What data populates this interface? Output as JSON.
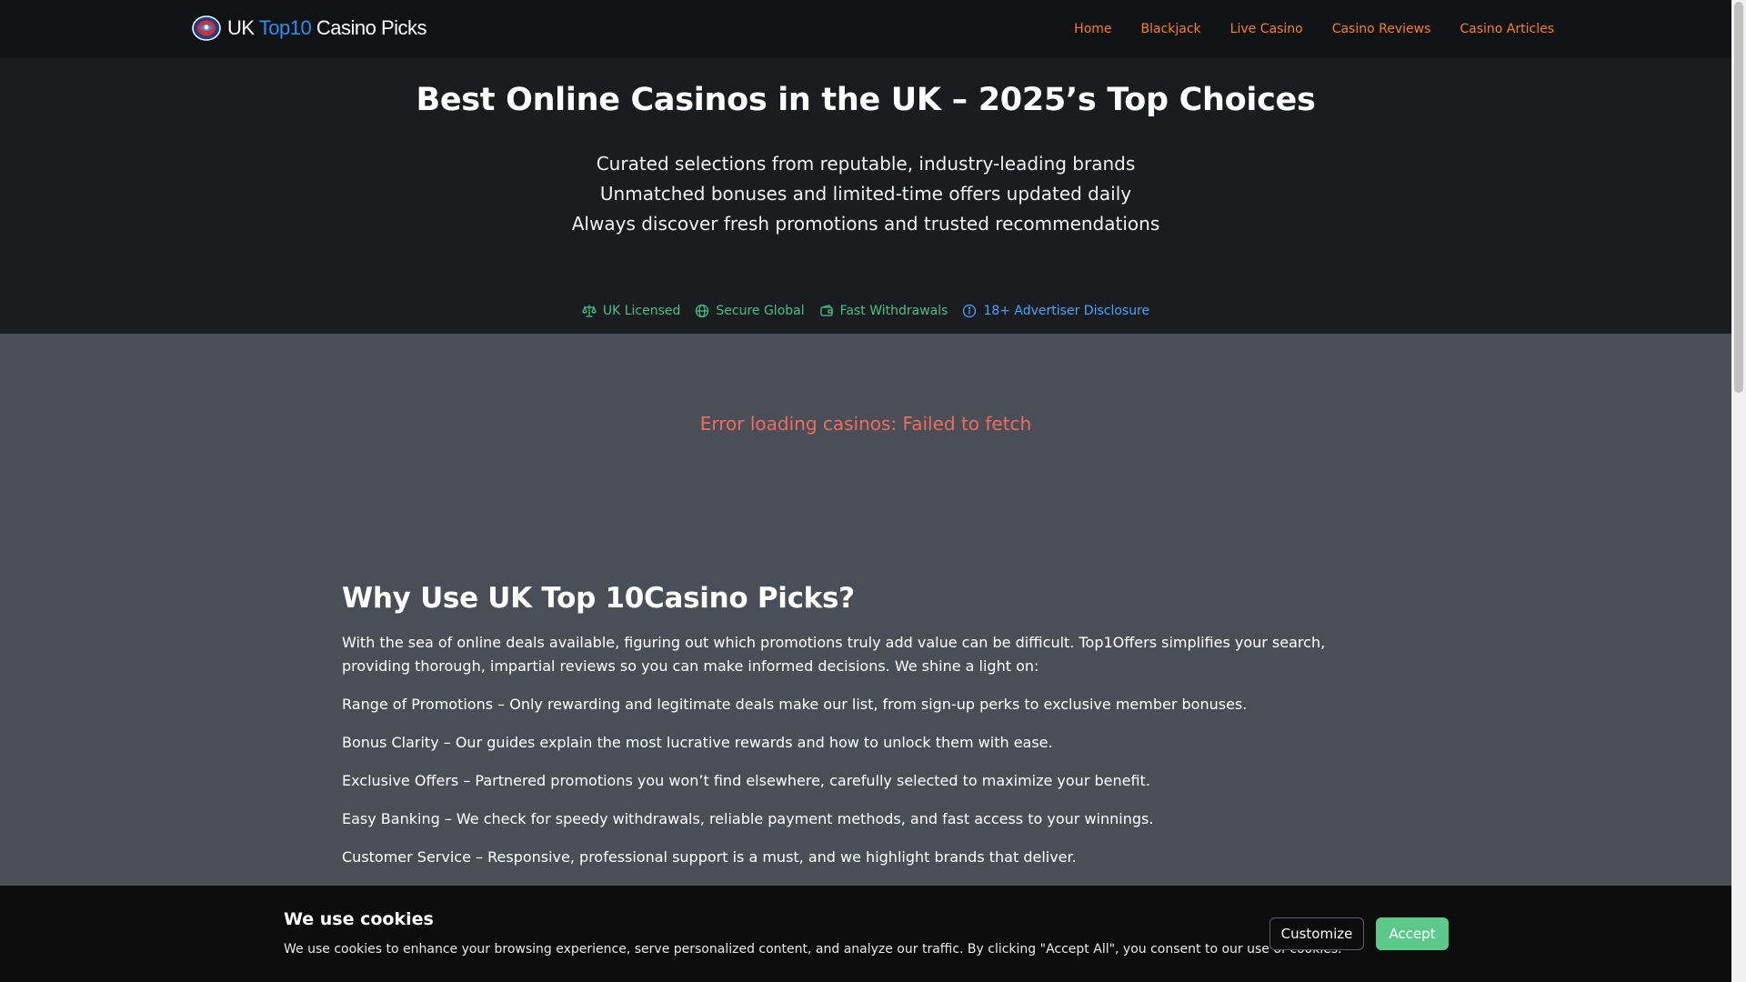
{
  "header": {
    "logo": {
      "uk": "UK",
      "top10": "Top10",
      "rest": "Casino Picks"
    },
    "nav": [
      "Home",
      "Blackjack",
      "Live Casino",
      "Casino Reviews",
      "Casino Articles"
    ]
  },
  "hero": {
    "title": "Best Online Casinos in the UK – 2025’s Top Choices",
    "lines": [
      "Curated selections from reputable, industry-leading brands",
      "Unmatched bonuses and limited-time offers updated daily",
      "Always discover fresh promotions and trusted recommendations"
    ],
    "badges": [
      {
        "icon": "scale-icon",
        "label": "UK Licensed"
      },
      {
        "icon": "globe-icon",
        "label": "Secure Global"
      },
      {
        "icon": "wallet-icon",
        "label": "Fast Withdrawals"
      },
      {
        "icon": "info-icon",
        "label": "18+ Advertiser Disclosure"
      }
    ]
  },
  "error": "Error loading casinos: Failed to fetch",
  "why": {
    "heading": "Why Use UK Top 10Casino Picks?",
    "intro": "With the sea of online deals available, figuring out which promotions truly add value can be difficult. Top1Offers simplifies your search, providing thorough, impartial reviews so you can make informed decisions. We shine a light on:",
    "items": [
      "Range of Promotions – Only rewarding and legitimate deals make our list, from sign-up perks to exclusive member bonuses.",
      "Bonus Clarity – Our guides explain the most lucrative rewards and how to unlock them with ease.",
      "Exclusive Offers – Partnered promotions you won’t find elsewhere, carefully selected to maximize your benefit.",
      "Easy Banking – We check for speedy withdrawals, reliable payment methods, and fast access to your winnings.",
      "Customer Service – Responsive, professional support is a must, and we highlight brands that deliver."
    ]
  },
  "cookie": {
    "title": "We use cookies",
    "message": "We use cookies to enhance your browsing experience, serve personalized content, and analyze our traffic. By clicking \"Accept All\", you consent to our use of cookies.",
    "customize": "Customize",
    "accept": "Accept"
  },
  "colors": {
    "nav": "#f58220",
    "badge": "#46c08a",
    "disclosure": "#4aa3ff",
    "error": "#ef6b5e",
    "accept": "#5cc98b",
    "logo_accent": "#2e8ef5"
  }
}
